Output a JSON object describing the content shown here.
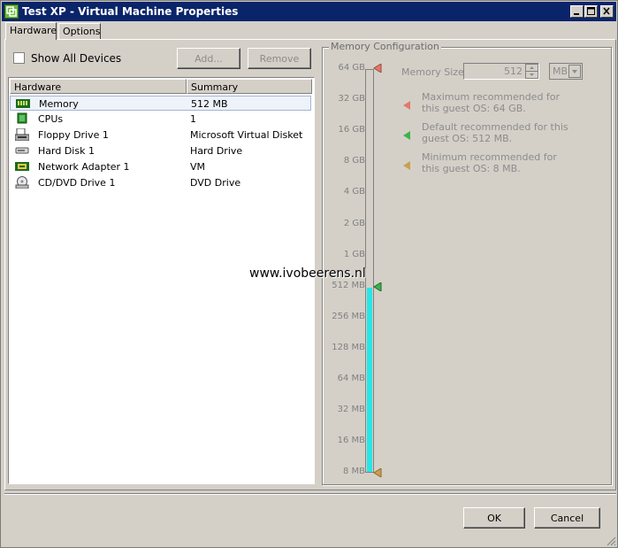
{
  "window": {
    "title": "Test XP - Virtual Machine Properties",
    "controls": [
      "minimize",
      "maximize",
      "close"
    ]
  },
  "tabs": [
    {
      "label": "Hardware",
      "active": true
    },
    {
      "label": "Options",
      "active": false
    }
  ],
  "show_all_devices": {
    "label": "Show All Devices",
    "checked": false
  },
  "buttons": {
    "add": "Add...",
    "remove": "Remove",
    "ok": "OK",
    "cancel": "Cancel"
  },
  "hardware_table": {
    "columns": [
      "Hardware",
      "Summary"
    ],
    "rows": [
      {
        "name": "Memory",
        "summary": "512 MB",
        "icon": "memory-icon",
        "selected": true
      },
      {
        "name": "CPUs",
        "summary": "1",
        "icon": "cpu-icon",
        "selected": false
      },
      {
        "name": "Floppy Drive 1",
        "summary": "Microsoft Virtual Disket...",
        "icon": "floppy-icon",
        "selected": false
      },
      {
        "name": "Hard Disk 1",
        "summary": "Hard Drive",
        "icon": "hard-disk-icon",
        "selected": false
      },
      {
        "name": "Network Adapter 1",
        "summary": "VM",
        "icon": "network-adapter-icon",
        "selected": false
      },
      {
        "name": "CD/DVD Drive 1",
        "summary": "DVD Drive",
        "icon": "cd-dvd-icon",
        "selected": false
      }
    ]
  },
  "memory_config": {
    "group_label": "Memory Configuration",
    "scale_labels": [
      "64 GB",
      "32 GB",
      "16 GB",
      "8 GB",
      "4 GB",
      "2 GB",
      "1 GB",
      "512 MB",
      "256 MB",
      "128 MB",
      "64 MB",
      "32 MB",
      "16 MB",
      "8 MB"
    ],
    "current_value": "512 MB",
    "memory_size_label": "Memory Size:",
    "memory_size_value": "512",
    "unit": "MB",
    "legend": [
      {
        "text": "Maximum recommended for this guest OS: 64 GB.",
        "color": "#e07a6a"
      },
      {
        "text": "Default recommended for this guest OS: 512 MB.",
        "color": "#3cb44a"
      },
      {
        "text": "Minimum recommended for this guest OS: 8 MB.",
        "color": "#c8a050"
      }
    ],
    "fill_color": "#27e6e6"
  },
  "watermark": "www.ivobeerens.nl"
}
